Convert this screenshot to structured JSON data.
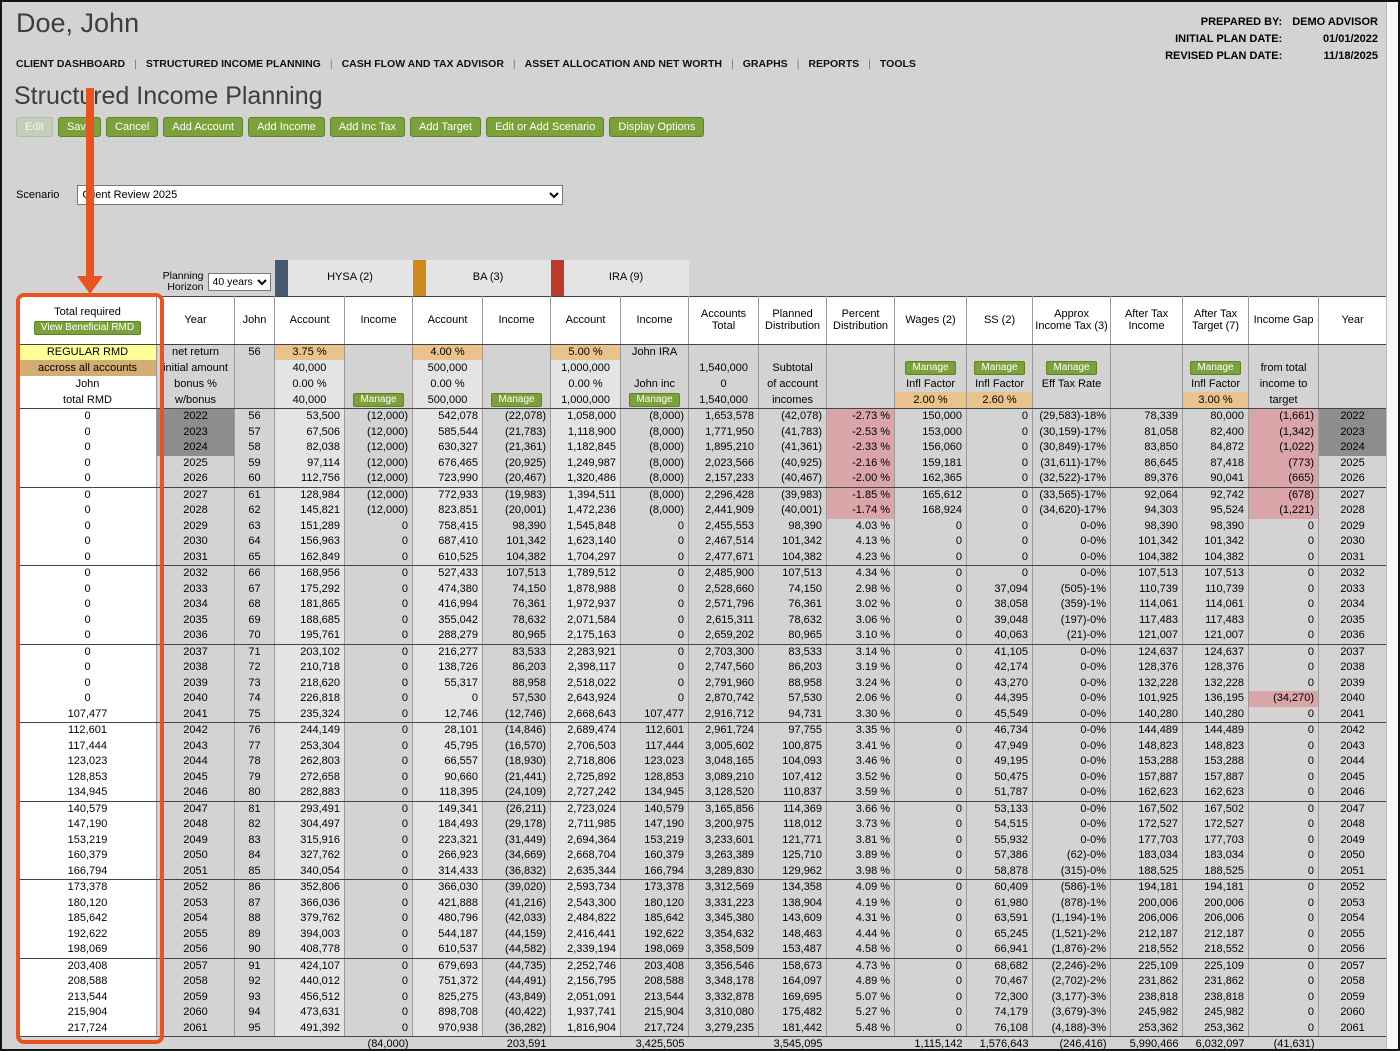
{
  "header": {
    "client_name": "Doe, John",
    "plan_info": [
      {
        "label": "PREPARED BY:",
        "value": "DEMO ADVISOR"
      },
      {
        "label": "INITIAL PLAN DATE:",
        "value": "01/01/2022"
      },
      {
        "label": "REVISED PLAN DATE:",
        "value": "11/18/2025"
      }
    ],
    "nav_items": [
      "CLIENT DASHBOARD",
      "STRUCTURED INCOME PLANNING",
      "CASH FLOW AND TAX ADVISOR",
      "ASSET ALLOCATION AND NET WORTH",
      "GRAPHS",
      "REPORTS",
      "TOOLS"
    ]
  },
  "page": {
    "title": "Structured Income Planning"
  },
  "toolbar": {
    "buttons": [
      "Edit",
      "Save",
      "Cancel",
      "Add Account",
      "Add Income",
      "Add Inc Tax",
      "Add Target",
      "Edit or Add Scenario",
      "Display Options"
    ],
    "disabled": "Edit"
  },
  "scenario": {
    "label": "Scenario",
    "value": "Client Review 2025"
  },
  "planning": {
    "label": "Planning Horizon",
    "value": "40 years"
  },
  "rmd_panel": {
    "title": "Total required",
    "button": "View Beneficial RMD",
    "side_labels": [
      "REGULAR RMD",
      "accross all accounts",
      "John",
      "total RMD"
    ]
  },
  "annotation": {
    "color": "#e9531f"
  },
  "table": {
    "groups": [
      {
        "label": "HYSA (2)",
        "color": "#47596e"
      },
      {
        "label": "BA (3)",
        "color": "#cf8a1d"
      },
      {
        "label": "IRA (9)",
        "color": "#bc3a2c"
      }
    ],
    "columns": [
      "Year",
      "John",
      "Account",
      "Income",
      "Account",
      "Income",
      "Account",
      "Income",
      "Accounts Total",
      "Planned Distribution",
      "Percent Distribution",
      "Wages (2)",
      "SS (2)",
      "Approx Income Tax (3)",
      "After Tax Income",
      "After Tax Target (7)",
      "Income Gap",
      "Year"
    ],
    "subheader_rows": [
      [
        "net return",
        "56",
        "3.75 %",
        "",
        "4.00 %",
        "",
        "5.00 %",
        "John IRA",
        "",
        "",
        "",
        "",
        "",
        "",
        "",
        "",
        "",
        ""
      ],
      [
        "initial amount",
        "",
        "40,000",
        "",
        "500,000",
        "",
        "1,000,000",
        "",
        "1,540,000",
        "Subtotal",
        "",
        "Manage",
        "Manage",
        "Manage",
        "",
        "Manage",
        "from total",
        ""
      ],
      [
        "bonus %",
        "",
        "0.00 %",
        "",
        "0.00 %",
        "",
        "0.00 %",
        "John inc",
        "0",
        "of account",
        "",
        "Infl Factor",
        "Infl Factor",
        "Eff Tax Rate",
        "",
        "Infl Factor",
        "income to",
        ""
      ],
      [
        "w/bonus",
        "",
        "40,000",
        "Manage",
        "500,000",
        "Manage",
        "1,000,000",
        "Manage",
        "1,540,000",
        "incomes",
        "",
        "2.00 %",
        "2.60 %",
        "",
        "",
        "3.00 %",
        "target",
        ""
      ]
    ],
    "rows": [
      [
        "0",
        "2022",
        "56",
        "53,500",
        "(12,000)",
        "542,078",
        "(22,078)",
        "1,058,000",
        "(8,000)",
        "1,653,578",
        "(42,078)",
        "-2.73 %",
        "150,000",
        "0",
        "(29,583)-18%",
        "78,339",
        "80,000",
        "(1,661)",
        "2022"
      ],
      [
        "0",
        "2023",
        "57",
        "67,506",
        "(12,000)",
        "585,544",
        "(21,783)",
        "1,118,900",
        "(8,000)",
        "1,771,950",
        "(41,783)",
        "-2.53 %",
        "153,000",
        "0",
        "(30,159)-17%",
        "81,058",
        "82,400",
        "(1,342)",
        "2023"
      ],
      [
        "0",
        "2024",
        "58",
        "82,038",
        "(12,000)",
        "630,327",
        "(21,361)",
        "1,182,845",
        "(8,000)",
        "1,895,210",
        "(41,361)",
        "-2.33 %",
        "156,060",
        "0",
        "(30,849)-17%",
        "83,850",
        "84,872",
        "(1,022)",
        "2024"
      ],
      [
        "0",
        "2025",
        "59",
        "97,114",
        "(12,000)",
        "676,465",
        "(20,925)",
        "1,249,987",
        "(8,000)",
        "2,023,566",
        "(40,925)",
        "-2.16 %",
        "159,181",
        "0",
        "(31,611)-17%",
        "86,645",
        "87,418",
        "(773)",
        "2025"
      ],
      [
        "0",
        "2026",
        "60",
        "112,756",
        "(12,000)",
        "723,990",
        "(20,467)",
        "1,320,486",
        "(8,000)",
        "2,157,233",
        "(40,467)",
        "-2.00 %",
        "162,365",
        "0",
        "(32,522)-17%",
        "89,376",
        "90,041",
        "(665)",
        "2026"
      ],
      [
        "0",
        "2027",
        "61",
        "128,984",
        "(12,000)",
        "772,933",
        "(19,983)",
        "1,394,511",
        "(8,000)",
        "2,296,428",
        "(39,983)",
        "-1.85 %",
        "165,612",
        "0",
        "(33,565)-17%",
        "92,064",
        "92,742",
        "(678)",
        "2027"
      ],
      [
        "0",
        "2028",
        "62",
        "145,821",
        "(12,000)",
        "823,851",
        "(20,001)",
        "1,472,236",
        "(8,000)",
        "2,441,909",
        "(40,001)",
        "-1.74 %",
        "168,924",
        "0",
        "(34,620)-17%",
        "94,303",
        "95,524",
        "(1,221)",
        "2028"
      ],
      [
        "0",
        "2029",
        "63",
        "151,289",
        "0",
        "758,415",
        "98,390",
        "1,545,848",
        "0",
        "2,455,553",
        "98,390",
        "4.03 %",
        "0",
        "0",
        "0-0%",
        "98,390",
        "98,390",
        "0",
        "2029"
      ],
      [
        "0",
        "2030",
        "64",
        "156,963",
        "0",
        "687,410",
        "101,342",
        "1,623,140",
        "0",
        "2,467,514",
        "101,342",
        "4.13 %",
        "0",
        "0",
        "0-0%",
        "101,342",
        "101,342",
        "0",
        "2030"
      ],
      [
        "0",
        "2031",
        "65",
        "162,849",
        "0",
        "610,525",
        "104,382",
        "1,704,297",
        "0",
        "2,477,671",
        "104,382",
        "4.23 %",
        "0",
        "0",
        "0-0%",
        "104,382",
        "104,382",
        "0",
        "2031"
      ],
      [
        "0",
        "2032",
        "66",
        "168,956",
        "0",
        "527,433",
        "107,513",
        "1,789,512",
        "0",
        "2,485,900",
        "107,513",
        "4.34 %",
        "0",
        "0",
        "0-0%",
        "107,513",
        "107,513",
        "0",
        "2032"
      ],
      [
        "0",
        "2033",
        "67",
        "175,292",
        "0",
        "474,380",
        "74,150",
        "1,878,988",
        "0",
        "2,528,660",
        "74,150",
        "2.98 %",
        "0",
        "37,094",
        "(505)-1%",
        "110,739",
        "110,739",
        "0",
        "2033"
      ],
      [
        "0",
        "2034",
        "68",
        "181,865",
        "0",
        "416,994",
        "76,361",
        "1,972,937",
        "0",
        "2,571,796",
        "76,361",
        "3.02 %",
        "0",
        "38,058",
        "(359)-1%",
        "114,061",
        "114,061",
        "0",
        "2034"
      ],
      [
        "0",
        "2035",
        "69",
        "188,685",
        "0",
        "355,042",
        "78,632",
        "2,071,584",
        "0",
        "2,615,311",
        "78,632",
        "3.06 %",
        "0",
        "39,048",
        "(197)-0%",
        "117,483",
        "117,483",
        "0",
        "2035"
      ],
      [
        "0",
        "2036",
        "70",
        "195,761",
        "0",
        "288,279",
        "80,965",
        "2,175,163",
        "0",
        "2,659,202",
        "80,965",
        "3.10 %",
        "0",
        "40,063",
        "(21)-0%",
        "121,007",
        "121,007",
        "0",
        "2036"
      ],
      [
        "0",
        "2037",
        "71",
        "203,102",
        "0",
        "216,277",
        "83,533",
        "2,283,921",
        "0",
        "2,703,300",
        "83,533",
        "3.14 %",
        "0",
        "41,105",
        "0-0%",
        "124,637",
        "124,637",
        "0",
        "2037"
      ],
      [
        "0",
        "2038",
        "72",
        "210,718",
        "0",
        "138,726",
        "86,203",
        "2,398,117",
        "0",
        "2,747,560",
        "86,203",
        "3.19 %",
        "0",
        "42,174",
        "0-0%",
        "128,376",
        "128,376",
        "0",
        "2038"
      ],
      [
        "0",
        "2039",
        "73",
        "218,620",
        "0",
        "55,317",
        "88,958",
        "2,518,022",
        "0",
        "2,791,960",
        "88,958",
        "3.24 %",
        "0",
        "43,270",
        "0-0%",
        "132,228",
        "132,228",
        "0",
        "2039"
      ],
      [
        "0",
        "2040",
        "74",
        "226,818",
        "0",
        "0",
        "57,530",
        "2,643,924",
        "0",
        "2,870,742",
        "57,530",
        "2.06 %",
        "0",
        "44,395",
        "0-0%",
        "101,925",
        "136,195",
        "(34,270)",
        "2040"
      ],
      [
        "107,477",
        "2041",
        "75",
        "235,324",
        "0",
        "12,746",
        "(12,746)",
        "2,668,643",
        "107,477",
        "2,916,712",
        "94,731",
        "3.30 %",
        "0",
        "45,549",
        "0-0%",
        "140,280",
        "140,280",
        "0",
        "2041"
      ],
      [
        "112,601",
        "2042",
        "76",
        "244,149",
        "0",
        "28,101",
        "(14,846)",
        "2,689,474",
        "112,601",
        "2,961,724",
        "97,755",
        "3.35 %",
        "0",
        "46,734",
        "0-0%",
        "144,489",
        "144,489",
        "0",
        "2042"
      ],
      [
        "117,444",
        "2043",
        "77",
        "253,304",
        "0",
        "45,795",
        "(16,570)",
        "2,706,503",
        "117,444",
        "3,005,602",
        "100,875",
        "3.41 %",
        "0",
        "47,949",
        "0-0%",
        "148,823",
        "148,823",
        "0",
        "2043"
      ],
      [
        "123,023",
        "2044",
        "78",
        "262,803",
        "0",
        "66,557",
        "(18,930)",
        "2,718,806",
        "123,023",
        "3,048,165",
        "104,093",
        "3.46 %",
        "0",
        "49,195",
        "0-0%",
        "153,288",
        "153,288",
        "0",
        "2044"
      ],
      [
        "128,853",
        "2045",
        "79",
        "272,658",
        "0",
        "90,660",
        "(21,441)",
        "2,725,892",
        "128,853",
        "3,089,210",
        "107,412",
        "3.52 %",
        "0",
        "50,475",
        "0-0%",
        "157,887",
        "157,887",
        "0",
        "2045"
      ],
      [
        "134,945",
        "2046",
        "80",
        "282,883",
        "0",
        "118,395",
        "(24,109)",
        "2,727,242",
        "134,945",
        "3,128,520",
        "110,837",
        "3.59 %",
        "0",
        "51,787",
        "0-0%",
        "162,623",
        "162,623",
        "0",
        "2046"
      ],
      [
        "140,579",
        "2047",
        "81",
        "293,491",
        "0",
        "149,341",
        "(26,211)",
        "2,723,024",
        "140,579",
        "3,165,856",
        "114,369",
        "3.66 %",
        "0",
        "53,133",
        "0-0%",
        "167,502",
        "167,502",
        "0",
        "2047"
      ],
      [
        "147,190",
        "2048",
        "82",
        "304,497",
        "0",
        "184,493",
        "(29,178)",
        "2,711,985",
        "147,190",
        "3,200,975",
        "118,012",
        "3.73 %",
        "0",
        "54,515",
        "0-0%",
        "172,527",
        "172,527",
        "0",
        "2048"
      ],
      [
        "153,219",
        "2049",
        "83",
        "315,916",
        "0",
        "223,321",
        "(31,449)",
        "2,694,364",
        "153,219",
        "3,233,601",
        "121,771",
        "3.81 %",
        "0",
        "55,932",
        "0-0%",
        "177,703",
        "177,703",
        "0",
        "2049"
      ],
      [
        "160,379",
        "2050",
        "84",
        "327,762",
        "0",
        "266,923",
        "(34,669)",
        "2,668,704",
        "160,379",
        "3,263,389",
        "125,710",
        "3.89 %",
        "0",
        "57,386",
        "(62)-0%",
        "183,034",
        "183,034",
        "0",
        "2050"
      ],
      [
        "166,794",
        "2051",
        "85",
        "340,054",
        "0",
        "314,433",
        "(36,832)",
        "2,635,344",
        "166,794",
        "3,289,830",
        "129,962",
        "3.98 %",
        "0",
        "58,878",
        "(315)-0%",
        "188,525",
        "188,525",
        "0",
        "2051"
      ],
      [
        "173,378",
        "2052",
        "86",
        "352,806",
        "0",
        "366,030",
        "(39,020)",
        "2,593,734",
        "173,378",
        "3,312,569",
        "134,358",
        "4.09 %",
        "0",
        "60,409",
        "(586)-1%",
        "194,181",
        "194,181",
        "0",
        "2052"
      ],
      [
        "180,120",
        "2053",
        "87",
        "366,036",
        "0",
        "421,888",
        "(41,216)",
        "2,543,300",
        "180,120",
        "3,331,223",
        "138,904",
        "4.19 %",
        "0",
        "61,980",
        "(878)-1%",
        "200,006",
        "200,006",
        "0",
        "2053"
      ],
      [
        "185,642",
        "2054",
        "88",
        "379,762",
        "0",
        "480,796",
        "(42,033)",
        "2,484,822",
        "185,642",
        "3,345,380",
        "143,609",
        "4.31 %",
        "0",
        "63,591",
        "(1,194)-1%",
        "206,006",
        "206,006",
        "0",
        "2054"
      ],
      [
        "192,622",
        "2055",
        "89",
        "394,003",
        "0",
        "544,187",
        "(44,159)",
        "2,416,441",
        "192,622",
        "3,354,632",
        "148,463",
        "4.44 %",
        "0",
        "65,245",
        "(1,521)-2%",
        "212,187",
        "212,187",
        "0",
        "2055"
      ],
      [
        "198,069",
        "2056",
        "90",
        "408,778",
        "0",
        "610,537",
        "(44,582)",
        "2,339,194",
        "198,069",
        "3,358,509",
        "153,487",
        "4.58 %",
        "0",
        "66,941",
        "(1,876)-2%",
        "218,552",
        "218,552",
        "0",
        "2056"
      ],
      [
        "203,408",
        "2057",
        "91",
        "424,107",
        "0",
        "679,693",
        "(44,735)",
        "2,252,746",
        "203,408",
        "3,356,546",
        "158,673",
        "4.73 %",
        "0",
        "68,682",
        "(2,246)-2%",
        "225,109",
        "225,109",
        "0",
        "2057"
      ],
      [
        "208,588",
        "2058",
        "92",
        "440,012",
        "0",
        "751,372",
        "(44,491)",
        "2,156,795",
        "208,588",
        "3,348,178",
        "164,097",
        "4.89 %",
        "0",
        "70,467",
        "(2,702)-2%",
        "231,862",
        "231,862",
        "0",
        "2058"
      ],
      [
        "213,544",
        "2059",
        "93",
        "456,512",
        "0",
        "825,275",
        "(43,849)",
        "2,051,091",
        "213,544",
        "3,332,878",
        "169,695",
        "5.07 %",
        "0",
        "72,300",
        "(3,177)-3%",
        "238,818",
        "238,818",
        "0",
        "2059"
      ],
      [
        "215,904",
        "2060",
        "94",
        "473,631",
        "0",
        "898,708",
        "(40,422)",
        "1,937,741",
        "215,904",
        "3,310,080",
        "175,482",
        "5.27 %",
        "0",
        "74,179",
        "(3,679)-3%",
        "245,982",
        "245,982",
        "0",
        "2060"
      ],
      [
        "217,724",
        "2061",
        "95",
        "491,392",
        "0",
        "970,938",
        "(36,282)",
        "1,816,904",
        "217,724",
        "3,279,235",
        "181,442",
        "5.48 %",
        "0",
        "76,108",
        "(4,188)-3%",
        "253,362",
        "253,362",
        "0",
        "2061"
      ]
    ],
    "totals": [
      "",
      "",
      "",
      "",
      "(84,000)",
      "",
      "203,591",
      "",
      "3,425,505",
      "",
      "3,545,095",
      "",
      "1,115,142",
      "1,576,643",
      "(246,416)",
      "5,990,466",
      "6,032,097",
      "(41,631)",
      ""
    ]
  }
}
